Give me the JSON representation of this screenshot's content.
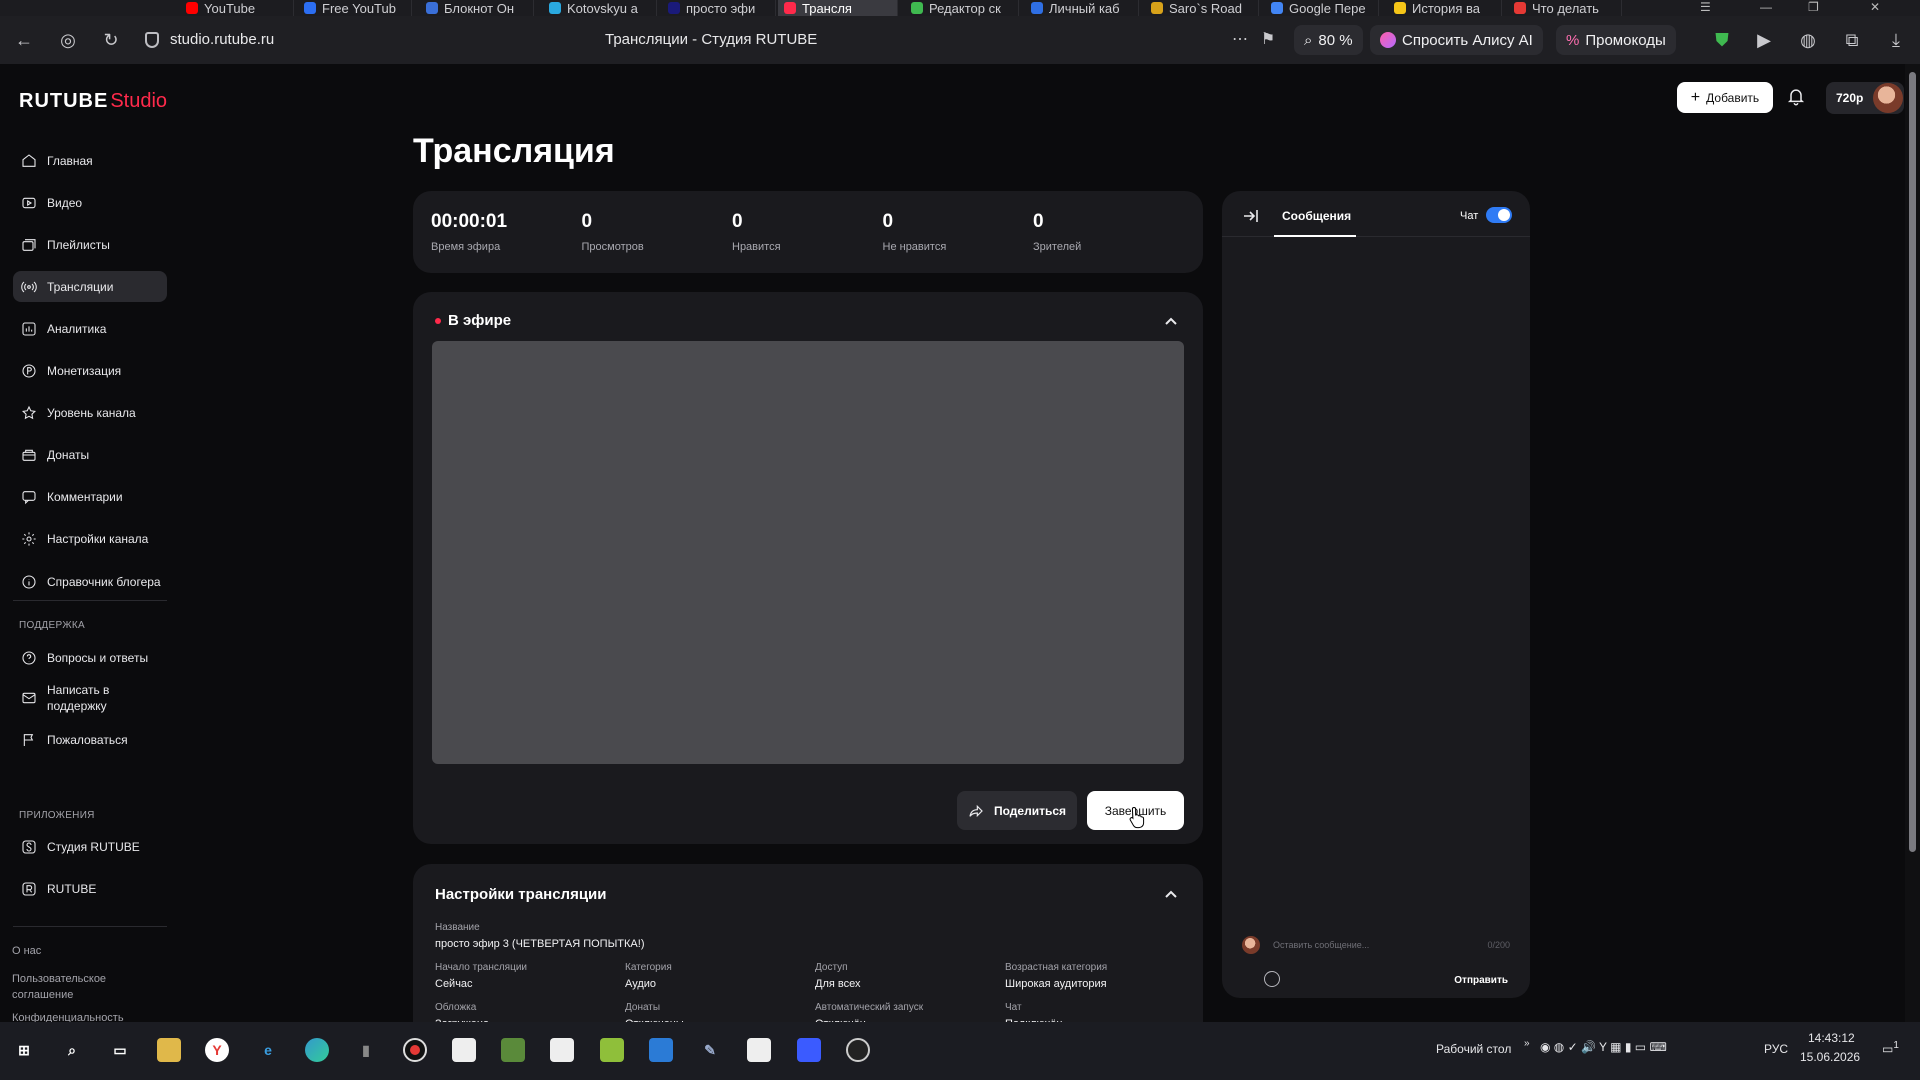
{
  "browser": {
    "tabs": [
      {
        "label": "YouTube",
        "color": "#ff0000"
      },
      {
        "label": "Free YouTub",
        "color": "#2c6ef2"
      },
      {
        "label": "Блокнот Он",
        "color": "#3a6fd8"
      },
      {
        "label": "Kotovskyu a",
        "color": "#2aa9e0"
      },
      {
        "label": "просто эфи",
        "color": "#1a1a7a"
      },
      {
        "label": "Трансля",
        "color": "#ff2a4b"
      },
      {
        "label": "Редактор ск",
        "color": "#3fb950"
      },
      {
        "label": "Личный каб",
        "color": "#2f6fe4"
      },
      {
        "label": "Saro`s Road",
        "color": "#d8a21a"
      },
      {
        "label": "Google Пере",
        "color": "#4285f4"
      },
      {
        "label": "История ва",
        "color": "#f5c518"
      },
      {
        "label": "Что делать",
        "color": "#e53935"
      }
    ],
    "active_tab_index": 5,
    "url": "studio.rutube.ru",
    "page_title": "Трансляции - Студия RUTUBE",
    "zoom": "80 %",
    "alice_label": "Спросить Алису AI",
    "promo_label": "Промокоды"
  },
  "app": {
    "logo_main": "RUTUBE",
    "logo_studio": "Studio",
    "add_button": "Добавить",
    "quality": "720p",
    "page_title": "Трансляция"
  },
  "sidebar": {
    "items": [
      {
        "label": "Главная",
        "icon": "home-icon"
      },
      {
        "label": "Видео",
        "icon": "video-icon"
      },
      {
        "label": "Плейлисты",
        "icon": "playlist-icon"
      },
      {
        "label": "Трансляции",
        "icon": "broadcast-icon",
        "active": true
      },
      {
        "label": "Аналитика",
        "icon": "analytics-icon"
      },
      {
        "label": "Монетизация",
        "icon": "monetization-icon"
      },
      {
        "label": "Уровень канала",
        "icon": "star-icon"
      },
      {
        "label": "Донаты",
        "icon": "donate-icon"
      },
      {
        "label": "Комментарии",
        "icon": "comment-icon"
      },
      {
        "label": "Настройки канала",
        "icon": "gear-icon"
      },
      {
        "label": "Справочник блогера",
        "icon": "info-icon"
      }
    ],
    "support_title": "ПОДДЕРЖКА",
    "support_items": [
      {
        "label": "Вопросы и ответы",
        "icon": "question-icon"
      },
      {
        "label": "Написать в поддержку",
        "icon": "mail-icon"
      },
      {
        "label": "Пожаловаться",
        "icon": "flag-icon"
      }
    ],
    "apps_title": "ПРИЛОЖЕНИЯ",
    "apps_items": [
      {
        "label": "Студия RUTUBE",
        "icon": "studio-app-icon"
      },
      {
        "label": "RUTUBE",
        "icon": "rutube-app-icon"
      }
    ],
    "footer": [
      "О нас",
      "Пользовательское соглашение",
      "Конфиденциальность"
    ]
  },
  "stats": [
    {
      "value": "00:00:01",
      "label": "Время эфира"
    },
    {
      "value": "0",
      "label": "Просмотров"
    },
    {
      "value": "0",
      "label": "Нравится"
    },
    {
      "value": "0",
      "label": "Не нравится"
    },
    {
      "value": "0",
      "label": "Зрителей"
    }
  ],
  "live": {
    "title": "В эфире",
    "share_button": "Поделиться",
    "end_button": "Завершить"
  },
  "settings": {
    "title": "Настройки трансляции",
    "name_label": "Название",
    "name_value": "просто эфир 3 (ЧЕТВЕРТАЯ ПОПЫТКА!)",
    "fields_row1": [
      {
        "label": "Начало трансляции",
        "value": "Сейчас"
      },
      {
        "label": "Категория",
        "value": "Аудио"
      },
      {
        "label": "Доступ",
        "value": "Для всех"
      },
      {
        "label": "Возрастная категория",
        "value": "Широкая аудитория"
      }
    ],
    "fields_row2": [
      {
        "label": "Обложка",
        "value": "Загружена"
      },
      {
        "label": "Донаты",
        "value": "Отключены"
      },
      {
        "label": "Автоматический запуск",
        "value": "Отключён"
      },
      {
        "label": "Чат",
        "value": "Подключён"
      }
    ]
  },
  "chat": {
    "tab": "Сообщения",
    "chat_label": "Чат",
    "chat_enabled": true,
    "placeholder": "Оставить сообщение...",
    "counter": "0/200",
    "send": "Отправить"
  },
  "taskbar": {
    "desktop_label": "Рабочий стол",
    "lang": "РУС",
    "time": "14:43:12",
    "date": "15.06.2026",
    "notification_count": "1"
  }
}
